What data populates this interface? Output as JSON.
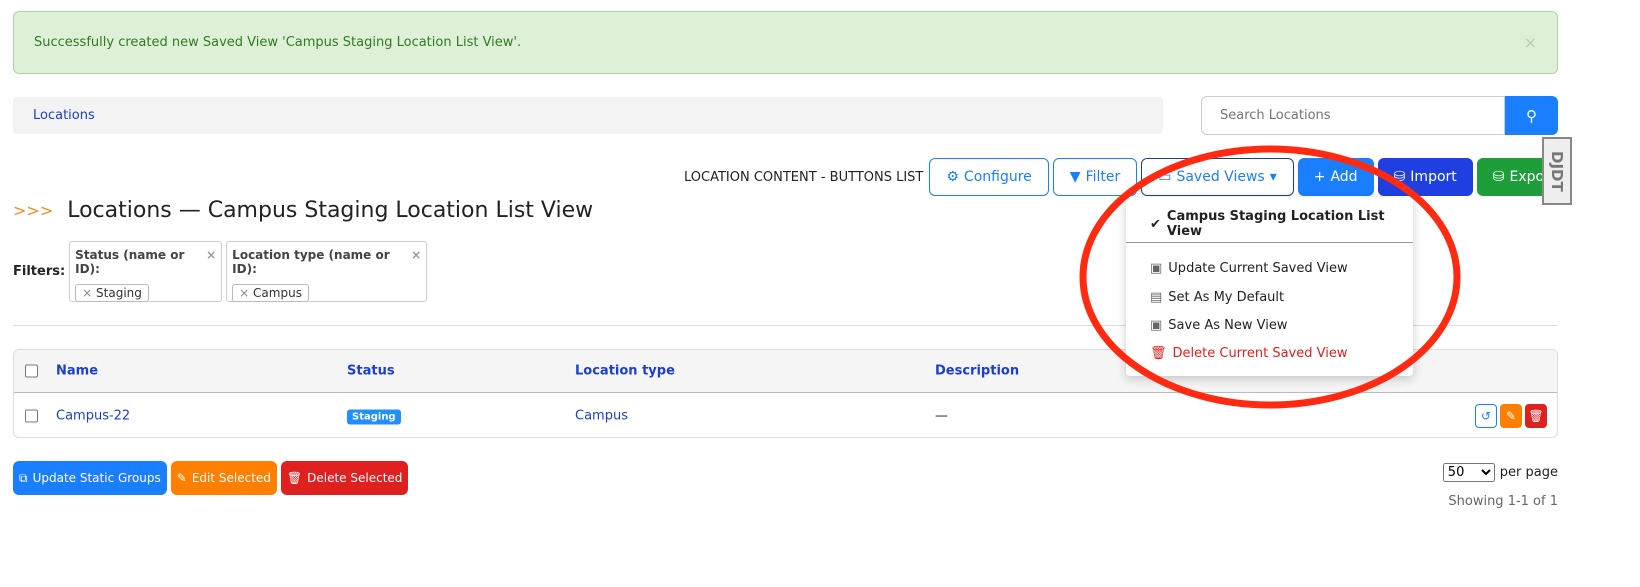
{
  "alert": {
    "message": "Successfully created new Saved View 'Campus Staging Location List View'.",
    "close": "×"
  },
  "breadcrumb": {
    "item": "Locations"
  },
  "search": {
    "placeholder": "Search Locations",
    "icon": "search-icon"
  },
  "toolbar": {
    "label": "LOCATION CONTENT - BUTTONS LIST",
    "configure": "Configure",
    "filter": "Filter",
    "saved_views": "Saved Views",
    "add": "Add",
    "import": "Import",
    "export": "Export"
  },
  "colors": {
    "primary": "#1a7fff",
    "import": "#1f3fe0",
    "export": "#1e9e3a",
    "edit": "#ff8000",
    "delete": "#e0201e",
    "alert_bg": "#dff0d8",
    "annotation": "#ff2a10"
  },
  "page": {
    "arrows": ">>>",
    "title": "Locations — Campus Staging Location List View"
  },
  "filters": {
    "label": "Filters:",
    "items": [
      {
        "name": "Status (name or ID):",
        "value": "Staging"
      },
      {
        "name": "Location type (name or ID):",
        "value": "Campus"
      }
    ]
  },
  "table": {
    "headers": [
      "Name",
      "Status",
      "Location type",
      "Description"
    ],
    "rows": [
      {
        "name": "Campus-22",
        "status": "Staging",
        "type": "Campus",
        "description": "—"
      }
    ]
  },
  "bulk": {
    "update": "Update Static Groups",
    "edit": "Edit Selected",
    "delete": "Delete Selected"
  },
  "pagination": {
    "per_page_value": "50",
    "per_page_label": "per page",
    "showing": "Showing 1-1 of 1"
  },
  "saved_views_menu": {
    "current": "Campus Staging Location List View",
    "items": [
      "Update Current Saved View",
      "Set As My Default",
      "Save As New View",
      "Delete Current Saved View"
    ]
  },
  "debug_toolbar": "DJDT"
}
